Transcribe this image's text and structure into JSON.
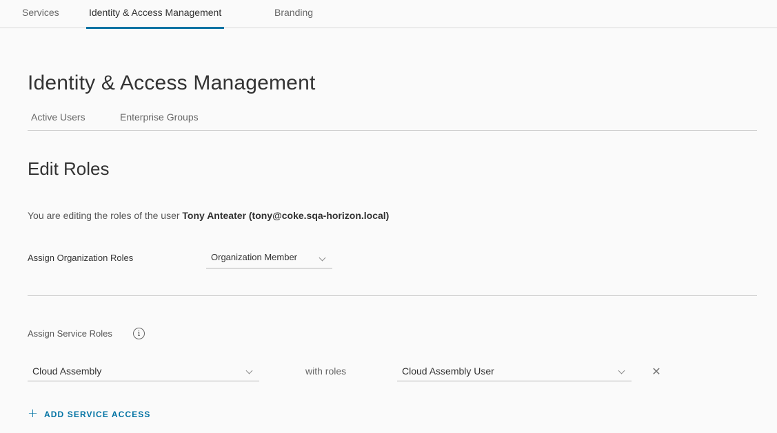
{
  "top_tabs": [
    {
      "label": "Services",
      "active": false
    },
    {
      "label": "Identity & Access Management",
      "active": true
    },
    {
      "label": "Branding",
      "active": false
    }
  ],
  "page_title": "Identity & Access Management",
  "sub_tabs": [
    {
      "label": "Active Users"
    },
    {
      "label": "Enterprise Groups"
    }
  ],
  "section_title": "Edit Roles",
  "editing": {
    "prefix": "You are editing the roles of the user ",
    "user": "Tony Anteater (tony@coke.sqa-horizon.local)"
  },
  "org_roles": {
    "label": "Assign Organization Roles",
    "selected": "Organization Member"
  },
  "service_roles": {
    "label": "Assign Service Roles",
    "info_icon": "info-icon",
    "service_selected": "Cloud Assembly",
    "with_roles_label": "with roles",
    "role_selected": "Cloud Assembly User",
    "remove_icon": "close-icon"
  },
  "add_service": {
    "icon": "plus-icon",
    "label": "ADD SERVICE ACCESS",
    "color": "#0072a3"
  },
  "colors": {
    "accent": "#0072a3",
    "background": "#fafafa"
  }
}
